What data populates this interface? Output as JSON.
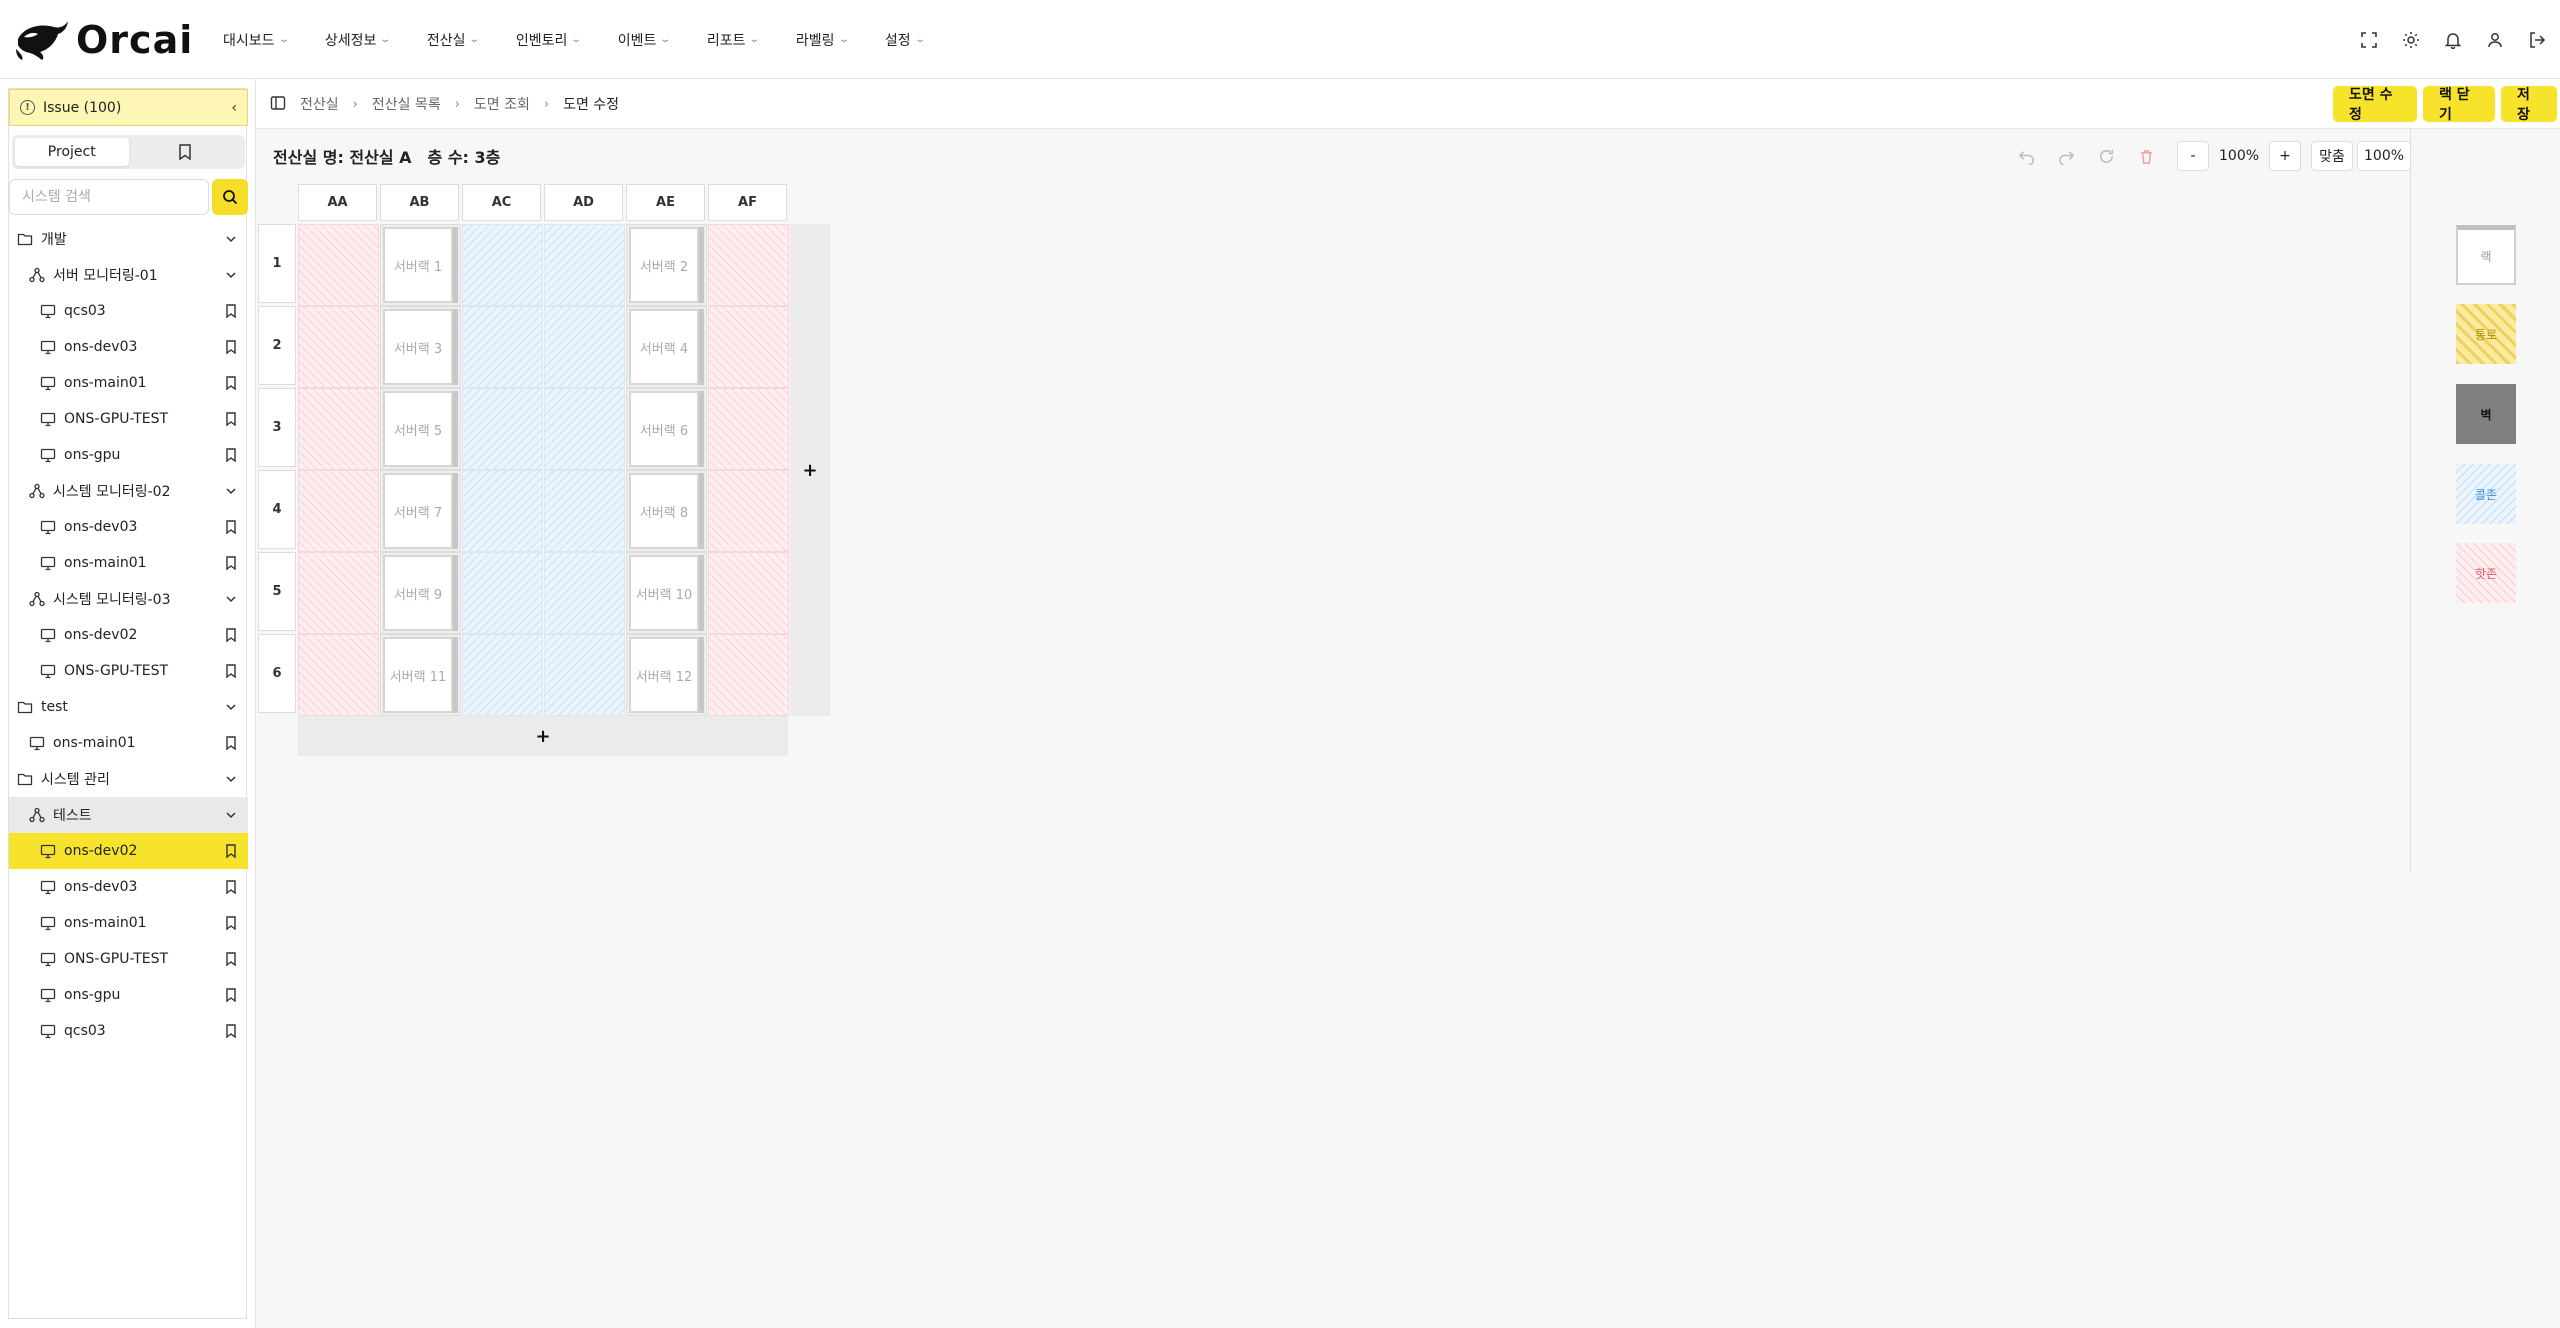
{
  "brand": {
    "name": "Orcai"
  },
  "nav": [
    "대시보드",
    "상세정보",
    "전산실",
    "인벤토리",
    "이벤트",
    "리포트",
    "라벨링",
    "설정"
  ],
  "top_icons": [
    "fullscreen-icon",
    "sun-icon",
    "bell-icon",
    "user-icon",
    "logout-icon"
  ],
  "sidebar": {
    "issue_label": "Issue (100)",
    "tabs": {
      "project": "Project",
      "bookmark_icon": "bookmark-icon"
    },
    "search_placeholder": "시스템 검색",
    "tree": [
      {
        "label": "개발",
        "type": "folder",
        "level": 0
      },
      {
        "label": "서버 모니터링-01",
        "type": "group",
        "level": 1
      },
      {
        "label": "qcs03",
        "type": "host",
        "level": 2
      },
      {
        "label": "ons-dev03",
        "type": "host",
        "level": 2
      },
      {
        "label": "ons-main01",
        "type": "host",
        "level": 2
      },
      {
        "label": "ONS-GPU-TEST",
        "type": "host",
        "level": 2
      },
      {
        "label": "ons-gpu",
        "type": "host",
        "level": 2
      },
      {
        "label": "시스템 모니터링-02",
        "type": "group",
        "level": 1
      },
      {
        "label": "ons-dev03",
        "type": "host",
        "level": 2
      },
      {
        "label": "ons-main01",
        "type": "host",
        "level": 2
      },
      {
        "label": "시스템 모니터링-03",
        "type": "group",
        "level": 1
      },
      {
        "label": "ons-dev02",
        "type": "host",
        "level": 2
      },
      {
        "label": "ONS-GPU-TEST",
        "type": "host",
        "level": 2
      },
      {
        "label": "test",
        "type": "folder",
        "level": 0
      },
      {
        "label": "ons-main01",
        "type": "host",
        "level": 1
      },
      {
        "label": "시스템 관리",
        "type": "folder",
        "level": 0
      },
      {
        "label": "테스트",
        "type": "group",
        "level": 1,
        "highlight": true
      },
      {
        "label": "ons-dev02",
        "type": "host",
        "level": 2,
        "selected": true
      },
      {
        "label": "ons-dev03",
        "type": "host",
        "level": 2
      },
      {
        "label": "ons-main01",
        "type": "host",
        "level": 2
      },
      {
        "label": "ONS-GPU-TEST",
        "type": "host",
        "level": 2
      },
      {
        "label": "ons-gpu",
        "type": "host",
        "level": 2
      },
      {
        "label": "qcs03",
        "type": "host",
        "level": 2
      }
    ]
  },
  "breadcrumb": [
    "전산실",
    "전산실 목록",
    "도면 조회",
    "도면 수정"
  ],
  "actions": {
    "edit_layout": "도면 수정",
    "close_rack": "랙 닫기",
    "save": "저장"
  },
  "room": {
    "name_label": "전산실 명: 전산실 A",
    "floors_label": "층 수: 3층"
  },
  "toolbar": {
    "zoom_out": "-",
    "zoom": "100%",
    "zoom_in": "+",
    "fit": "맞춤",
    "reset": "100%"
  },
  "grid": {
    "columns": [
      "AA",
      "AB",
      "AC",
      "AD",
      "AE",
      "AF"
    ],
    "rows": [
      "1",
      "2",
      "3",
      "4",
      "5",
      "6"
    ],
    "column_types": [
      "hot",
      "rack",
      "cold",
      "cold",
      "rack",
      "hot"
    ],
    "racks": [
      [
        "서버랙 1",
        "서버랙 2"
      ],
      [
        "서버랙 3",
        "서버랙 4"
      ],
      [
        "서버랙 5",
        "서버랙 6"
      ],
      [
        "서버랙 7",
        "서버랙 8"
      ],
      [
        "서버랙 9",
        "서버랙 10"
      ],
      [
        "서버랙 11",
        "서버랙 12"
      ]
    ],
    "add_symbol": "+"
  },
  "palette": {
    "rack": "랙",
    "aisle": "통로",
    "wall": "벽",
    "cold": "콜존",
    "hot": "핫존"
  },
  "colors": {
    "accent": "#f8e32c",
    "issue_bg": "#fdf6b4",
    "hot": "#fdeef0",
    "cold": "#eaf4fd",
    "wall": "#808080"
  }
}
